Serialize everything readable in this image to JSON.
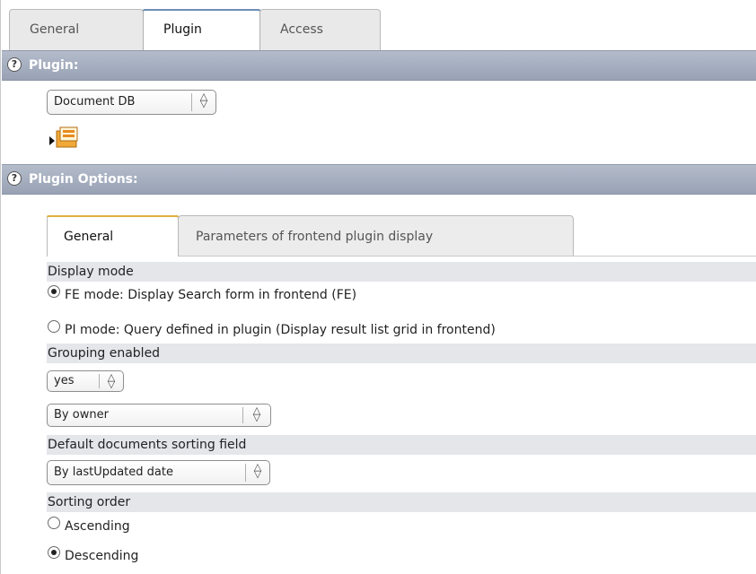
{
  "top_tabs": [
    {
      "label": "General",
      "active": false
    },
    {
      "label": "Plugin",
      "active": true
    },
    {
      "label": "Access",
      "active": false
    }
  ],
  "plugin_section": {
    "title": "Plugin:",
    "help_glyph": "?",
    "plugin_select": {
      "value": "Document DB"
    },
    "plugin_icon": "plugin-folder-icon"
  },
  "options_section": {
    "title": "Plugin Options:",
    "help_glyph": "?",
    "inner_tabs": [
      {
        "label": "General",
        "active": true
      },
      {
        "label": "Parameters of frontend plugin display",
        "active": false
      }
    ],
    "display_mode": {
      "label": "Display mode",
      "options": [
        {
          "label": "FE mode: Display Search form in frontend (FE)",
          "checked": true
        },
        {
          "label": "PI mode: Query defined in plugin (Display result list grid in frontend)",
          "checked": false
        }
      ]
    },
    "grouping": {
      "label": "Grouping enabled",
      "enabled_select": {
        "value": "yes"
      },
      "group_by_select": {
        "value": "By owner"
      }
    },
    "sorting_field": {
      "label": "Default documents sorting field",
      "select": {
        "value": "By lastUpdated date"
      }
    },
    "sorting_order": {
      "label": "Sorting order",
      "options": [
        {
          "label": "Ascending",
          "checked": false
        },
        {
          "label": "Descending",
          "checked": true
        }
      ]
    }
  },
  "colors": {
    "section_bar": "#a8b1c2",
    "active_tab_accent": "#6d8fb4",
    "inner_tab_accent": "#e0b040",
    "field_label_bg": "#e4e6ea"
  }
}
